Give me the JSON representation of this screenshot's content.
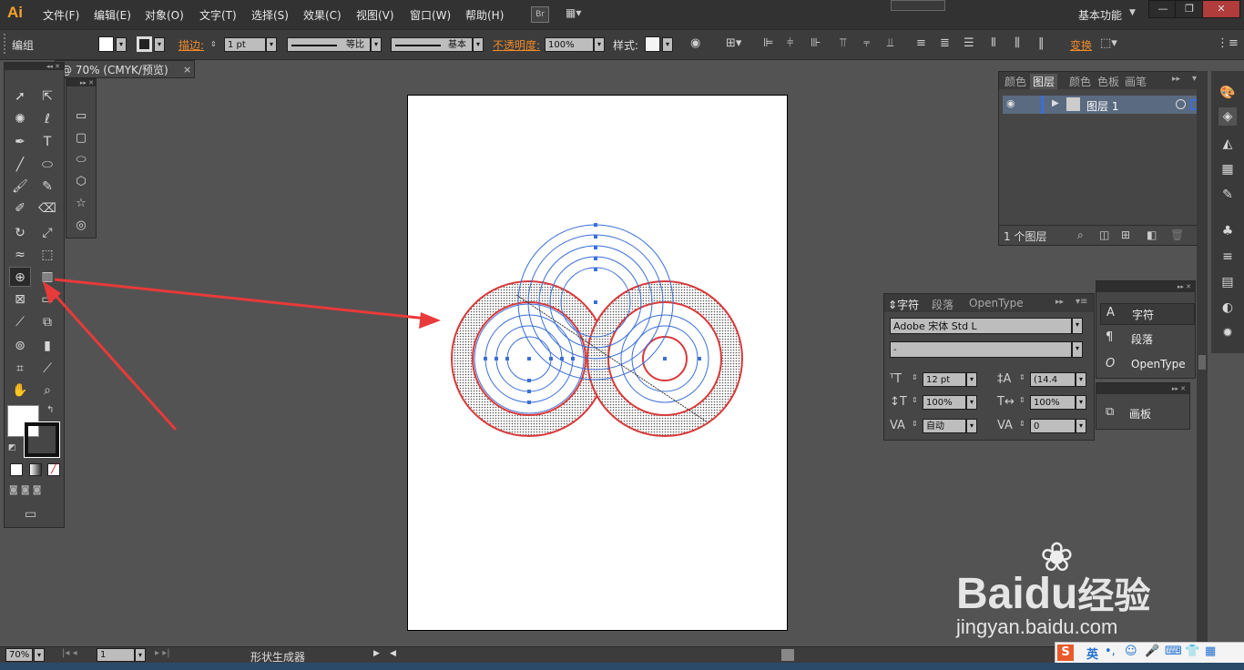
{
  "app": {
    "logo": "Ai",
    "bridge_label": "Br",
    "workspace": "基本功能"
  },
  "menu": [
    "文件(F)",
    "编辑(E)",
    "对象(O)",
    "文字(T)",
    "选择(S)",
    "效果(C)",
    "视图(V)",
    "窗口(W)",
    "帮助(H)"
  ],
  "control": {
    "selection_label": "编组",
    "stroke_label": "描边:",
    "stroke_weight": "1 pt",
    "profile_label": "等比",
    "brush_label": "基本",
    "opacity_label": "不透明度:",
    "opacity_value": "100%",
    "style_label": "样式:",
    "transform_label": "变换"
  },
  "document": {
    "tab_title": "@ 70% (CMYK/预览)"
  },
  "layers_panel": {
    "tabs": [
      "颜色",
      "图层",
      "颜色",
      "色板",
      "画笔"
    ],
    "layer_name": "图层 1",
    "footer_count": "1 个图层"
  },
  "character_panel": {
    "tabs": [
      "字符",
      "段落",
      "OpenType"
    ],
    "font_family": "Adobe 宋体 Std L",
    "font_style": "-",
    "font_size": "12 pt",
    "leading": "(14.4",
    "vertical_scale": "100%",
    "horizontal_scale": "100%",
    "kerning": "自动",
    "tracking": "0"
  },
  "collapsed_panel": {
    "items": [
      "字符",
      "段落",
      "OpenType"
    ]
  },
  "collapsed_panel2": {
    "items": [
      "画板"
    ]
  },
  "status": {
    "zoom": "70%",
    "artboard": "1",
    "tool_name": "形状生成器"
  },
  "ime": {
    "label": "英"
  },
  "watermark": {
    "brand": "Bai",
    "brand2": "du",
    "brand_cn": "经验",
    "url": "jingyan.baidu.com"
  },
  "colors": {
    "accent_orange": "#f08a2a",
    "selection_blue": "#3b6fd8",
    "arrow_red": "#e83a3a",
    "shape_red": "#d93a3a"
  }
}
